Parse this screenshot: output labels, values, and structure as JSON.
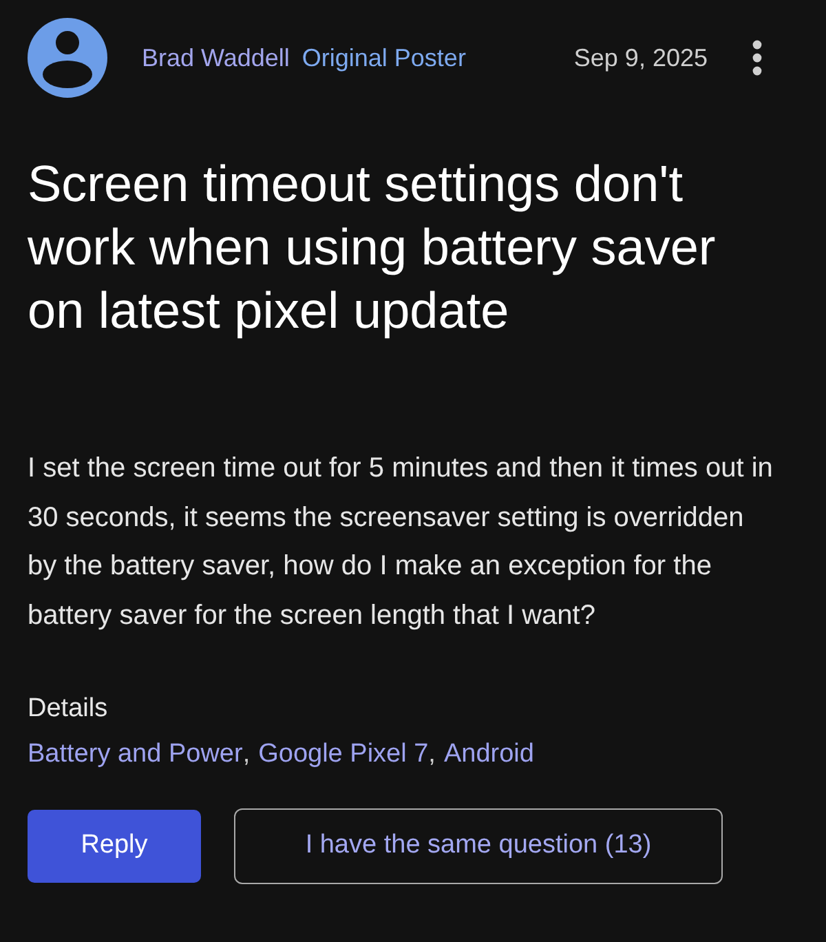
{
  "post": {
    "author": "Brad Waddell",
    "badge": "Original Poster",
    "date": "Sep 9, 2025",
    "title": "Screen timeout settings don't work when using battery saver on latest pixel update",
    "body": "I set the screen time out for 5 minutes and then it times out in 30 seconds, it seems the screensaver setting is overridden by the battery saver, how do I make an exception for the battery saver for the screen length that I want?",
    "details_heading": "Details",
    "details": [
      "Battery and Power",
      "Google Pixel 7",
      "Android"
    ],
    "separator": ",",
    "buttons": [
      {
        "label": "Reply",
        "kind": "primary"
      },
      {
        "label": "I have the same question (13)",
        "kind": "outline"
      }
    ]
  }
}
